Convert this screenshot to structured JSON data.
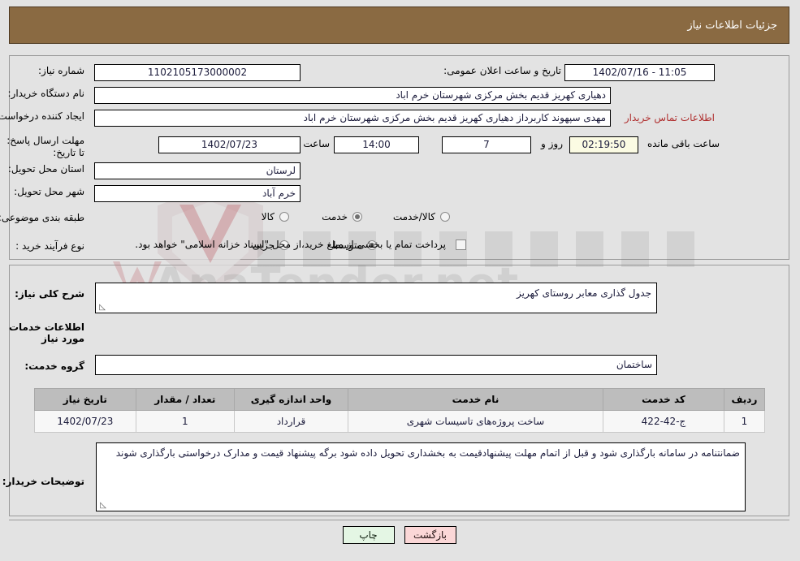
{
  "header": {
    "title": "جزئیات اطلاعات نیاز"
  },
  "form": {
    "need_number_label": "شماره نیاز:",
    "need_number_value": "1102105173000002",
    "announce_datetime_label": "تاریخ و ساعت اعلان عمومی:",
    "announce_datetime_value": "11:05 - 1402/07/16",
    "buyer_org_label": "نام دستگاه خریدار:",
    "buyer_org_value": "دهیاری کهریز قدیم بخش مرکزی شهرستان خرم اباد",
    "requester_label": "ایجاد کننده درخواست:",
    "requester_value": "مهدی سپهوند کاربرداز دهیاری کهریز قدیم بخش مرکزی شهرستان خرم اباد",
    "contact_link": "اطلاعات تماس خریدار",
    "deadline_label": "مهلت ارسال پاسخ: تا تاریخ:",
    "deadline_date": "1402/07/23",
    "deadline_hour_label": "ساعت",
    "deadline_hour": "14:00",
    "remaining_days": "7",
    "remaining_days_label": "روز و",
    "remaining_time": "02:19:50",
    "remaining_time_label": "ساعت باقی مانده",
    "province_label": "استان محل تحویل:",
    "province_value": "لرستان",
    "city_label": "شهر محل تحویل:",
    "city_value": "خرم آباد",
    "category_label": "طبقه بندی موضوعی:",
    "category_options": [
      {
        "label": "کالا",
        "checked": false
      },
      {
        "label": "خدمت",
        "checked": true
      },
      {
        "label": "کالا/خدمت",
        "checked": false
      }
    ],
    "process_label": "نوع فرآیند خرید :",
    "process_options": [
      {
        "label": "جزیی",
        "checked": false
      },
      {
        "label": "متوسط",
        "checked": true
      }
    ],
    "treasury_checkbox_label": "پرداخت تمام یا بخشی از مبلغ خرید،از محل \"اسناد خزانه اسلامی\" خواهد بود.",
    "treasury_checked": false
  },
  "description": {
    "general_need_label": "شرح کلی نیاز:",
    "general_need_value": "جدول گذاری معابر روستای کهریز",
    "services_section_title": "اطلاعات خدمات مورد نیاز",
    "service_group_label": "گروه خدمت:",
    "service_group_value": "ساختمان"
  },
  "table": {
    "columns": [
      "ردیف",
      "کد خدمت",
      "نام خدمت",
      "واحد اندازه گیری",
      "تعداد / مقدار",
      "تاریخ نیاز"
    ],
    "rows": [
      {
        "index": "1",
        "service_code": "ج-42-422",
        "service_name": "ساخت پروژه‌های تاسیسات شهری",
        "unit": "قرارداد",
        "quantity": "1",
        "need_date": "1402/07/23"
      }
    ]
  },
  "buyer_notes": {
    "label": "توضیحات خریدار:",
    "value": "ضمانتنامه در سامانه بارگذاری شود و قبل از اتمام مهلت پیشنهادقیمت به بخشداری تحویل داده شود برگه پیشنهاد قیمت و مدارک درخواستی بارگذاری شوند"
  },
  "buttons": {
    "print": "چاپ",
    "back": "بازگشت"
  },
  "watermark": {
    "text": "AnaTender.net"
  },
  "colors": {
    "header_bg": "#8a6a42",
    "link": "#b03030",
    "print_btn": "#e4f6e4",
    "back_btn": "#fbd7d7",
    "highlight_field": "#fbfbe3"
  }
}
